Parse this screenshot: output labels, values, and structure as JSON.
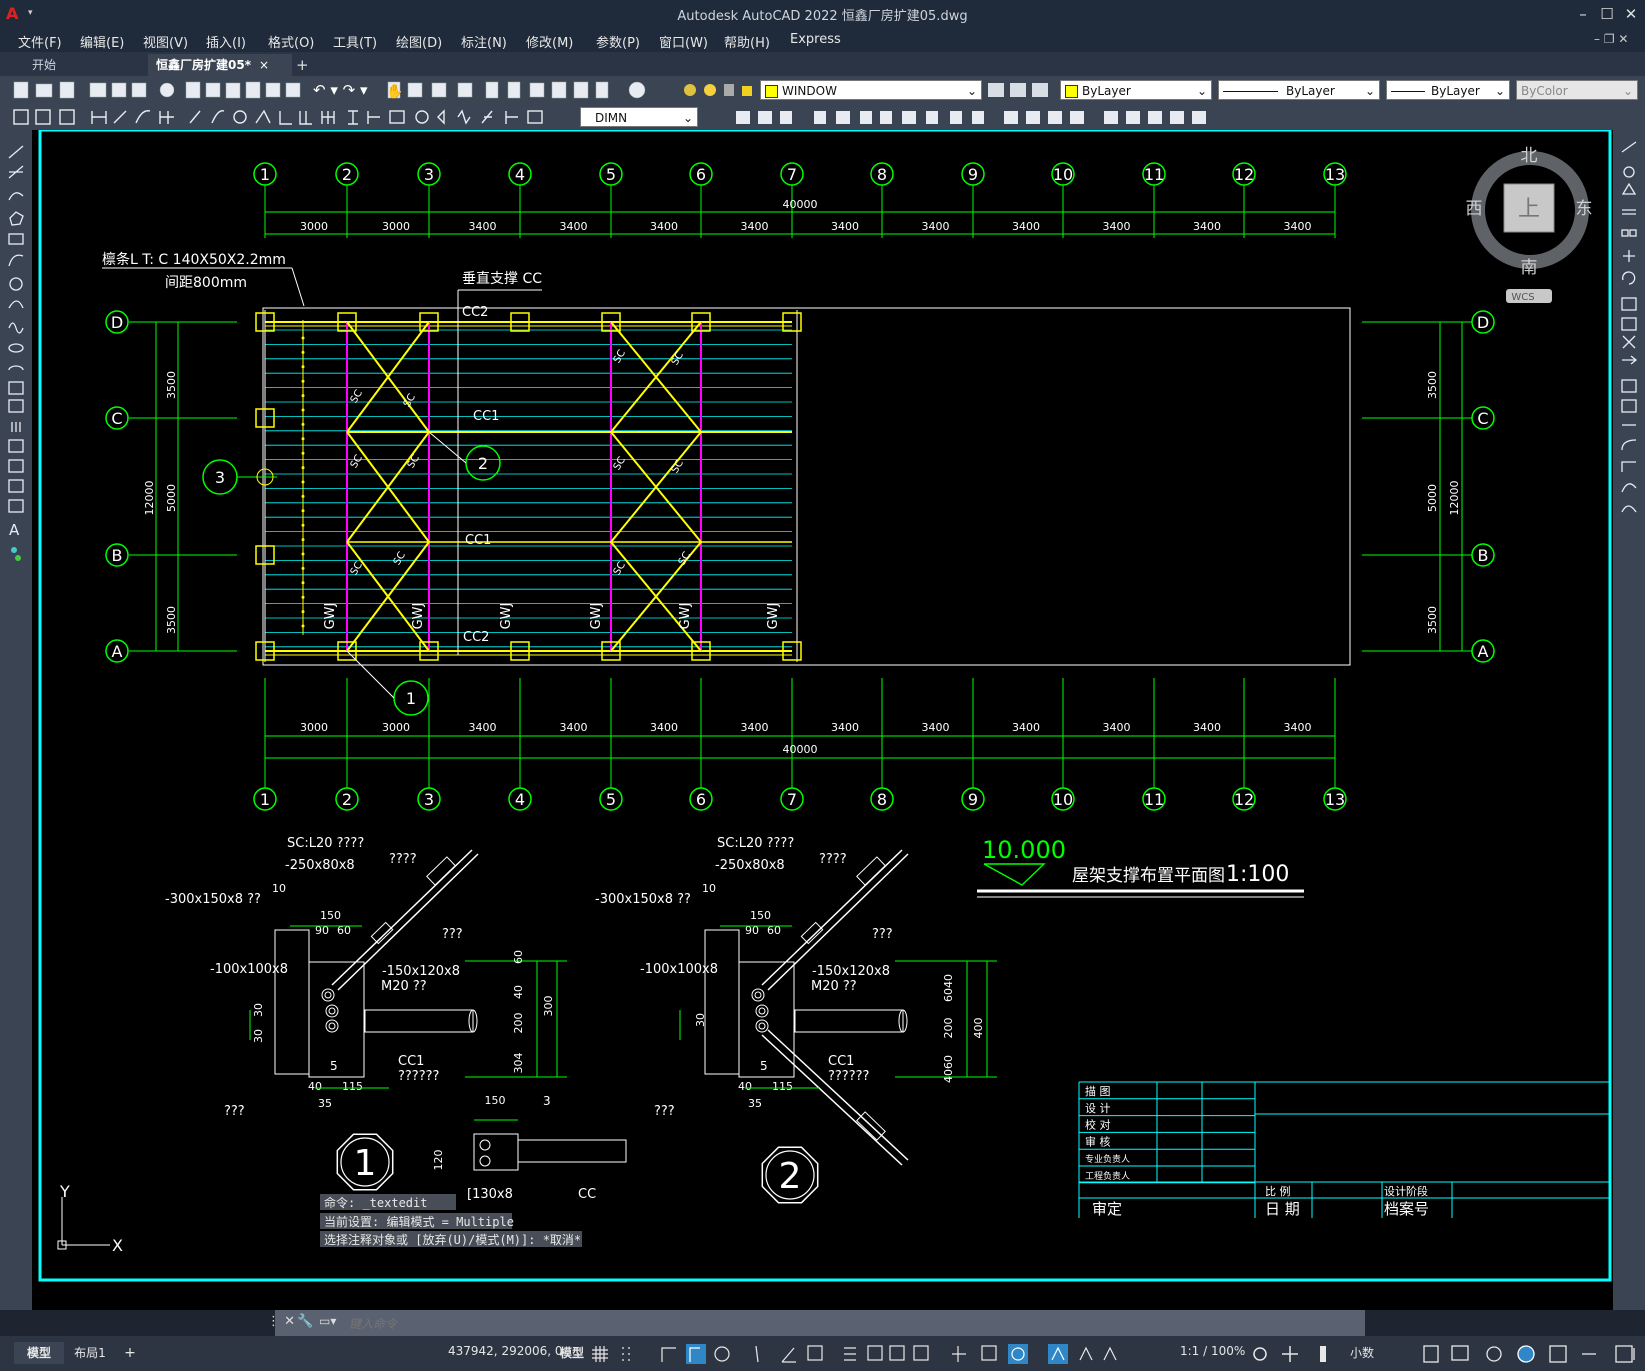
{
  "app": {
    "logo": "A",
    "title": "Autodesk AutoCAD 2022    恒鑫厂房扩建05.dwg",
    "window_controls": [
      "minimize-icon",
      "maximize-icon",
      "close-icon"
    ]
  },
  "menu": {
    "items": [
      "文件(F)",
      "编辑(E)",
      "视图(V)",
      "插入(I)",
      "格式(O)",
      "工具(T)",
      "绘图(D)",
      "标注(N)",
      "修改(M)",
      "参数(P)",
      "窗口(W)",
      "帮助(H)",
      "Express"
    ]
  },
  "tabs": {
    "start": "开始",
    "active": "恒鑫厂房扩建05*",
    "close": "×",
    "add": "+"
  },
  "toolbar": {
    "layer_name": "WINDOW",
    "color": "ByLayer",
    "linetype": "ByLayer",
    "lineweight": "ByLayer",
    "plotstyle": "ByColor",
    "dimstyle": "DIMN"
  },
  "viewcube": {
    "north": "北",
    "south": "南",
    "east": "东",
    "west": "西",
    "face": "上",
    "wcs": "WCS"
  },
  "drawing": {
    "grid_cols": [
      "1",
      "2",
      "3",
      "4",
      "5",
      "6",
      "7",
      "8",
      "9",
      "10",
      "11",
      "12",
      "13"
    ],
    "spacing": [
      "3000",
      "3000",
      "3400",
      "3400",
      "3400",
      "3400",
      "3400",
      "3400",
      "3400",
      "3400",
      "3400",
      "3400"
    ],
    "total": "40000",
    "grid_rows": [
      "D",
      "C",
      "B",
      "A"
    ],
    "row_spacing": [
      "3500",
      "5000",
      "3500"
    ],
    "row_total": "12000",
    "purlin_note_1": "檩条L T: C 140X50X2.2mm",
    "purlin_note_2": "间距800mm",
    "vert_brace": "垂直支撑 CC",
    "cc2": "CC2",
    "cc1": "CC1",
    "sc": "SC",
    "gwj": "GWJ",
    "callout_2": "2",
    "callout_1": "1",
    "callout_3": "3",
    "callout_2b": "2",
    "elevation": "10.000",
    "plan_title": "屋架支撑布置平面图",
    "plan_scale": "1:100",
    "d1": {
      "sc": "SC:L20 ????",
      "p250": "-250x80x8",
      "q1": "????",
      "p300": "-300x150x8  ??",
      "ten": "10",
      "d150": "150",
      "d90": "90",
      "d60": "60",
      "q2": "???",
      "p100": "-100x100x8",
      "p150": "-150x120x8",
      "m20": "M20 ??",
      "d30a": "30",
      "d30b": "30",
      "cc1": "CC1",
      "q3": "??????",
      "five": "5",
      "d40": "40",
      "d115": "115",
      "d35": "35",
      "q4": "???",
      "v60": "60",
      "v40": "40",
      "v200": "200",
      "v300": "300",
      "v304": "304",
      "c1": "1"
    },
    "d2": {
      "sc": "SC:L20 ????",
      "p250": "-250x80x8",
      "q1": "????",
      "p300": "-300x150x8  ??",
      "ten": "10",
      "d150": "150",
      "d90": "90",
      "d60": "60",
      "q2": "???",
      "p100": "-100x100x8",
      "p150": "-150x120x8",
      "m20": "M20 ??",
      "d30": "30",
      "cc1": "CC1",
      "q3": "??????",
      "five": "5",
      "d40": "40",
      "d115": "115",
      "d35": "35",
      "q4": "???",
      "v6040": "6040",
      "v200": "200",
      "v400": "400",
      "v4060": "4060",
      "c2": "2"
    },
    "d3": {
      "d150": "150",
      "three": "3",
      "d120": "120",
      "l130": "[130x8",
      "cc": "CC"
    },
    "ucs_y": "Y",
    "ucs_x": "X"
  },
  "titleblock": {
    "rows": [
      "描 图",
      "设 计",
      "校 对",
      "审 核",
      "专业负责人",
      "工程负责人"
    ],
    "bl1": "比 例",
    "bl2": "设计阶段",
    "b1": "审定",
    "b2": "日 期",
    "b3": "档案号"
  },
  "command": {
    "history": [
      "命令: _textedit",
      "当前设置: 编辑模式 = Multiple",
      "选择注释对象或 [放弃(U)/模式(M)]: *取消*"
    ],
    "placeholder": "键入命令"
  },
  "layout_tabs": [
    "模型",
    "布局1",
    "+"
  ],
  "status": {
    "coords": "437942, 292006, 0",
    "space": "模型",
    "scale": "1:1 / 100%",
    "units": "小数"
  }
}
